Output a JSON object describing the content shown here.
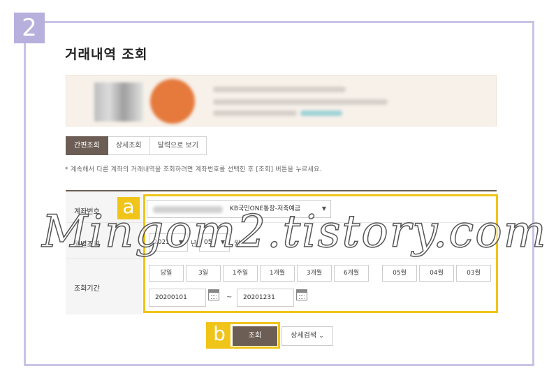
{
  "step_badge": "2",
  "page_title": "거래내역 조회",
  "tabs": [
    {
      "label": "간편조회",
      "active": true
    },
    {
      "label": "상세조회",
      "active": false
    },
    {
      "label": "달력으로 보기",
      "active": false
    }
  ],
  "notice": "* 계속해서 다른 계좌의 거래내역을 조회하려면 계좌번호를 선택한 후 [조회] 버튼을 누르세요.",
  "form": {
    "account_label": "계좌번호",
    "account_select_value": "KB국민ONE통장-저축예금",
    "monthly_label": "월별조회",
    "year_value": "2021",
    "year_unit": "년",
    "month_value": "05",
    "month_unit": "월",
    "period_label": "조회기간",
    "period_buttons": [
      "당일",
      "3일",
      "1주일",
      "1개월",
      "3개월",
      "6개월"
    ],
    "month_buttons": [
      "05월",
      "04월",
      "03월"
    ],
    "start_date": "20200101",
    "end_date": "20201231",
    "range_sep": "~"
  },
  "highlight_a": "a",
  "highlight_b": "b",
  "search_button": "조회",
  "detail_search_button": "상세검색",
  "watermark": "Mingom2.tistory.com",
  "icons": {
    "dropdown": "caret-down-icon",
    "calendar": "calendar-icon",
    "chevron": "chevron-down-icon"
  },
  "colors": {
    "accent_brown": "#6c5e55",
    "highlight_yellow": "#f0c419",
    "frame_lavender": "#c9c3e6"
  }
}
